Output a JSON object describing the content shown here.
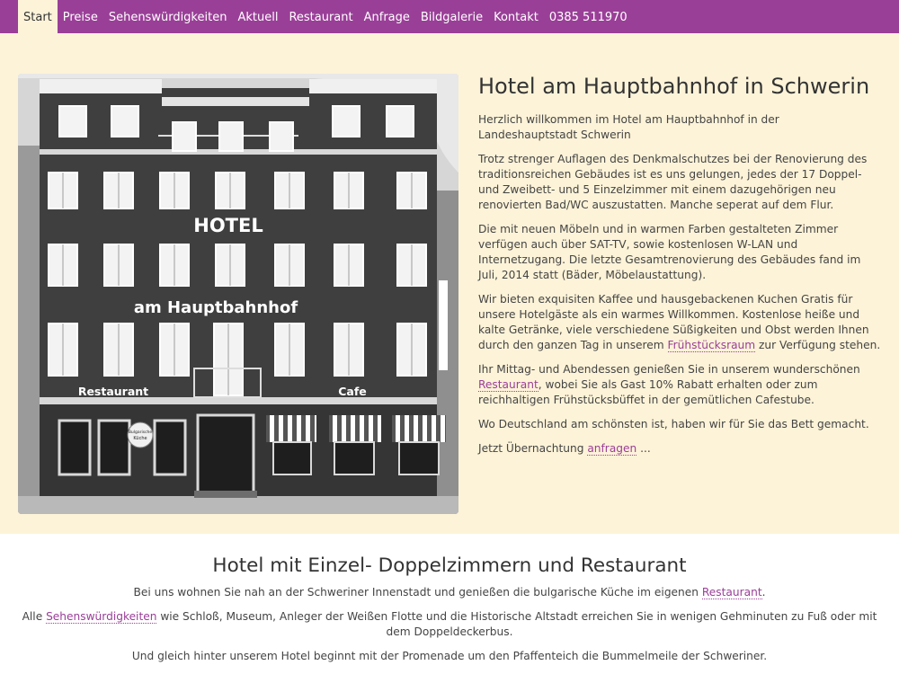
{
  "nav": {
    "items": [
      {
        "label": "Start",
        "active": true
      },
      {
        "label": "Preise"
      },
      {
        "label": "Sehenswürdigkeiten"
      },
      {
        "label": "Aktuell"
      },
      {
        "label": "Restaurant"
      },
      {
        "label": "Anfrage"
      },
      {
        "label": "Bildgalerie"
      },
      {
        "label": "Kontakt"
      },
      {
        "label": "0385 511970"
      }
    ]
  },
  "hero": {
    "photo": {
      "sign_hotel": "HOTEL",
      "sign_name": "am Hauptbahnhof",
      "sign_restaurant": "Restaurant",
      "sign_cafe": "Cafe",
      "sign_kueche_1": "Bulgarische",
      "sign_kueche_2": "Küche"
    },
    "title": "Hotel am Hauptbahnhof in Schwerin",
    "p1": "Herzlich willkommen im Hotel am Hauptbahnhof in der Landeshauptstadt Schwerin",
    "p2": "Trotz strenger Auflagen des Denkmalschutzes bei der Renovierung des traditionsreichen Gebäudes ist es uns gelungen, jedes der 17 Doppel- und Zweibett- und 5 Einzelzimmer mit einem dazugehörigen neu renovierten Bad/WC auszustatten. Manche seperat auf dem Flur.",
    "p3": "Die mit neuen Möbeln und in warmen Farben gestalteten Zimmer verfügen auch über SAT-TV, sowie kostenlosen W-LAN und Internetzugang. Die letzte Gesamtrenovierung des Gebäudes fand im Juli, 2014 statt (Bäder, Möbelaustattung).",
    "p4_before": "Wir bieten exquisiten Kaffee und hausgebackenen Kuchen Gratis für unsere Hotelgäste als ein warmes Willkommen. Kostenlose heiße und kalte Getränke, viele verschiedene Süßigkeiten und Obst werden Ihnen durch den ganzen Tag in unserem ",
    "p4_link": "Frühstücksraum",
    "p4_after": " zur Verfügung stehen.",
    "p5_before": "Ihr Mittag- und Abendessen genießen Sie in unserem wunderschönen ",
    "p5_link": "Restaurant",
    "p5_after": ", wobei Sie als Gast 10% Rabatt erhalten oder zum reichhaltigen Frühstücksbüffet in der gemütlichen Cafestube.",
    "p6": "Wo Deutschland am schönsten ist, haben wir für Sie das Bett gemacht.",
    "p7_before": "Jetzt Übernachtung ",
    "p7_link": "anfragen",
    "p7_after": " ..."
  },
  "info": {
    "title": "Hotel mit Einzel- Doppelzimmern und Restaurant",
    "p1_before": "Bei uns wohnen Sie nah an der Schweriner Innenstadt und genießen die bulgarische Küche im eigenen ",
    "p1_link": "Restaurant",
    "p1_after": ".",
    "p2_before": "Alle ",
    "p2_link": "Sehenswürdigkeiten",
    "p2_after": " wie Schloß, Museum, Anleger der Weißen Flotte und die Historische Altstadt erreichen Sie in wenigen Gehminuten zu Fuß oder mit dem Doppeldeckerbus.",
    "p3": "Und gleich hinter unserem Hotel beginnt mit der Promenade um den Pfaffenteich die Bummelmeile der Schweriner."
  },
  "colors": {
    "nav_bg": "#9a3f98",
    "hero_bg": "#fdf3d8",
    "link": "#9a3f98"
  }
}
